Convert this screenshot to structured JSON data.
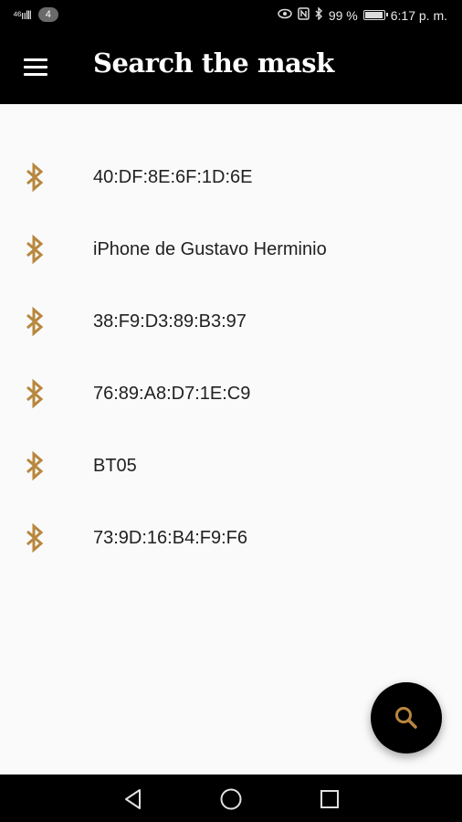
{
  "status_bar": {
    "signal": "⁴⁶ıılll",
    "notification_count": "4",
    "battery_percent": "99 %",
    "time": "6:17 p. m.",
    "battery_level": 0.99
  },
  "app_bar": {
    "title": "Search the mask",
    "menu_icon": "hamburger-menu-icon"
  },
  "accent_color": "#b8873e",
  "devices": [
    {
      "name": "40:DF:8E:6F:1D:6E",
      "icon": "bluetooth-icon"
    },
    {
      "name": "iPhone de Gustavo Herminio",
      "icon": "bluetooth-icon"
    },
    {
      "name": "38:F9:D3:89:B3:97",
      "icon": "bluetooth-icon"
    },
    {
      "name": "76:89:A8:D7:1E:C9",
      "icon": "bluetooth-icon"
    },
    {
      "name": "BT05",
      "icon": "bluetooth-icon"
    },
    {
      "name": "73:9D:16:B4:F9:F6",
      "icon": "bluetooth-icon"
    }
  ],
  "fab": {
    "icon": "search-icon"
  },
  "nav_bar": {
    "back_icon": "back-triangle-icon",
    "home_icon": "home-circle-icon",
    "recents_icon": "recents-square-icon"
  }
}
